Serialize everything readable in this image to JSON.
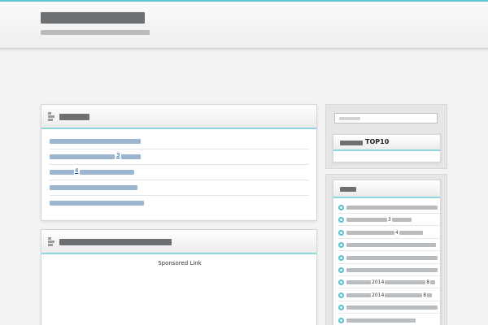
{
  "header": {
    "site_title": "",
    "site_description": ""
  },
  "main": {
    "new_posts": {
      "heading": "",
      "items": [
        {
          "label": ""
        },
        {
          "label": "",
          "inline_number": "3"
        },
        {
          "label": "",
          "inline_number": "4"
        },
        {
          "label": ""
        },
        {
          "label": ""
        }
      ]
    },
    "article": {
      "heading": "",
      "sponsored_label": "Sponsored Link"
    }
  },
  "sidebar": {
    "search": {
      "placeholder": ""
    },
    "ranking": {
      "title_prefix": "",
      "title_suffix": "TOP10"
    },
    "recent_posts": {
      "heading": "",
      "items": [
        {
          "label": ""
        },
        {
          "label": "",
          "inline_number": "3"
        },
        {
          "label": "",
          "inline_number": "4"
        },
        {
          "label": ""
        },
        {
          "label": ""
        },
        {
          "label": ""
        },
        {
          "label": "",
          "inline_number": "2014",
          "inline_number_2": "8"
        },
        {
          "label": "",
          "inline_number": "2014",
          "inline_number_2": "8"
        },
        {
          "label": ""
        },
        {
          "label": ""
        }
      ]
    }
  },
  "colors": {
    "accent": "#5fc7d3",
    "link": "#1a56a8",
    "background": "#f3f3f3"
  },
  "icons": {
    "section_heading": "stacked-bars-icon",
    "list_bullet": "circle-bullet-icon"
  }
}
